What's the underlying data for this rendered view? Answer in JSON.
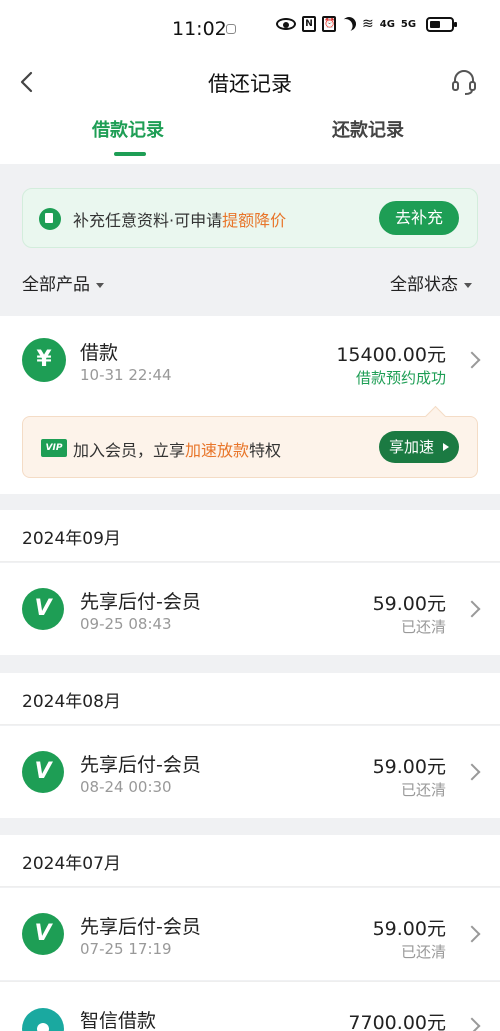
{
  "status_bar": {
    "time": "11:02",
    "network_labels": [
      "4G",
      "5G"
    ]
  },
  "navbar": {
    "title": "借还记录",
    "back_icon": "chevron-left-icon",
    "service_icon": "headset-icon"
  },
  "tabs": [
    {
      "label": "借款记录",
      "active": true
    },
    {
      "label": "还款记录",
      "active": false
    }
  ],
  "promo": {
    "text_prefix": "补充任意资料·可申请",
    "text_highlight": "提额降价",
    "button": "去补充"
  },
  "filters": {
    "product": "全部产品",
    "status": "全部状态"
  },
  "current_loan": {
    "icon_glyph": "¥",
    "name": "借款",
    "date": "10-31 22:44",
    "amount": "15400.00元",
    "status": "借款预约成功",
    "vip_banner": {
      "badge": "VIP",
      "text_prefix": "加入会员，立享",
      "text_highlight": "加速放款",
      "text_suffix": "特权",
      "button": "享加速"
    }
  },
  "months": [
    {
      "label": "2024年09月",
      "items": [
        {
          "icon_glyph": "V",
          "name": "先享后付-会员",
          "date": "09-25 08:43",
          "amount": "59.00元",
          "status": "已还清"
        }
      ]
    },
    {
      "label": "2024年08月",
      "items": [
        {
          "icon_glyph": "V",
          "name": "先享后付-会员",
          "date": "08-24 00:30",
          "amount": "59.00元",
          "status": "已还清"
        }
      ]
    },
    {
      "label": "2024年07月",
      "items": [
        {
          "icon_glyph": "V",
          "name": "先享后付-会员",
          "date": "07-25 17:19",
          "amount": "59.00元",
          "status": "已还清"
        },
        {
          "name": "智信借款",
          "amount": "7700.00元"
        }
      ]
    }
  ],
  "colors": {
    "accent_green": "#1e9e55",
    "highlight_orange": "#e8762b",
    "muted_gray": "#999999"
  }
}
